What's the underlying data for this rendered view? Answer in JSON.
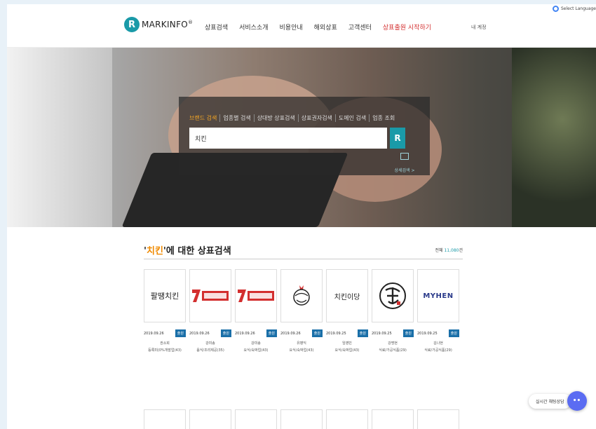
{
  "header": {
    "logo_mark": "R",
    "logo_text": "MARKINFO",
    "logo_reg": "®",
    "nav": [
      "상표검색",
      "서비스소개",
      "비용안내",
      "해외상표",
      "고객센터",
      "상표출원 시작하기"
    ],
    "login_label": "내 계정",
    "language_label": "Select Language"
  },
  "search": {
    "tabs": [
      "브랜드 검색",
      "업종별 검색",
      "상대방 상표검색",
      "상표권자검색",
      "도메인 검색",
      "업종 조회"
    ],
    "active_tab": 0,
    "query": "치킨",
    "button_mark": "R",
    "detail_label": "상세검색 >"
  },
  "results": {
    "keyword": "치킨",
    "title_suffix": "'에 대한 상표검색",
    "count_prefix": "전체 ",
    "count_value": "11,080",
    "count_suffix": "건",
    "items": [
      {
        "image": "팔땡치킨",
        "date": "2019.09.26",
        "status": "출원",
        "owner": "권소희",
        "cls": "등록미(0%개발업(43)"
      },
      {
        "image": "7번가피자치킨",
        "date": "2019.09.26",
        "status": "출원",
        "owner": "강미송",
        "cls": "음식/조리제공(35)"
      },
      {
        "image": "7번가피자치킨",
        "date": "2019.09.26",
        "status": "출원",
        "owner": "강미송",
        "cls": "요식/숙박업(43)"
      },
      {
        "image": "chicken-icon",
        "date": "2019.09.26",
        "status": "출원",
        "owner": "유병익",
        "cls": "요식/숙박업(43)"
      },
      {
        "image": "치킨이당",
        "date": "2019.09.25",
        "status": "출원",
        "owner": "임영민",
        "cls": "요식/숙박업(43)"
      },
      {
        "image": "calligraphy-logo",
        "date": "2019.09.25",
        "status": "출원",
        "owner": "강명현",
        "cls": "식료/가공식품(29)"
      },
      {
        "image": "MYHEN",
        "date": "2019.09.25",
        "status": "출원",
        "owner": "김나현",
        "cls": "식료/가공식품(29)"
      }
    ]
  },
  "chat": {
    "label": "실시간 채팅상담",
    "icon": "chat-bubble-icon"
  },
  "colors": {
    "brand": "#1a9aa8",
    "accent": "#f08a00",
    "highlight_nav": "#d32f2f",
    "badge": "#1a6fa8",
    "chat": "#5b6cf2"
  }
}
